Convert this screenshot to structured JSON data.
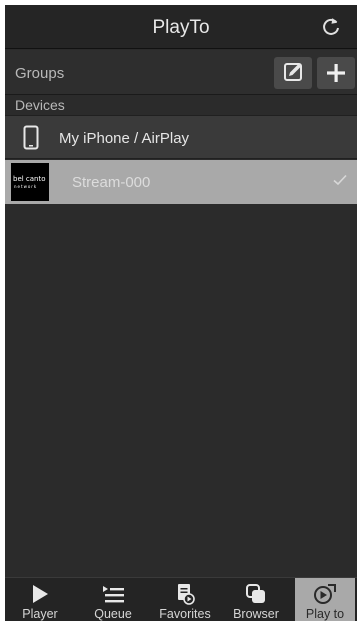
{
  "header": {
    "title": "PlayTo",
    "refresh_icon": "refresh-icon"
  },
  "groups": {
    "label": "Groups",
    "edit_icon": "edit-icon",
    "add_icon": "plus-icon"
  },
  "devices": {
    "label": "Devices",
    "items": [
      {
        "name": "My iPhone / AirPlay",
        "icon": "phone-icon",
        "selected": false
      },
      {
        "name": "Stream-000",
        "icon": "bel-canto-logo",
        "logo_text": "bel canto",
        "logo_subtext": "network",
        "selected": true
      }
    ]
  },
  "tabbar": {
    "tabs": [
      {
        "label": "Player",
        "icon": "play-icon"
      },
      {
        "label": "Queue",
        "icon": "queue-list-icon"
      },
      {
        "label": "Favorites",
        "icon": "favorites-icon"
      },
      {
        "label": "Browser",
        "icon": "browser-icon"
      },
      {
        "label": "Play to",
        "icon": "play-to-icon",
        "active": true
      }
    ]
  },
  "colors": {
    "background": "#2b2b2b",
    "selected_row": "#a9a9a9",
    "text": "#e6e6e6"
  }
}
